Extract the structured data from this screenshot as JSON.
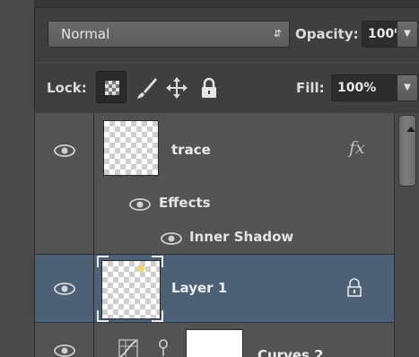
{
  "blend": {
    "mode": "Normal",
    "opacity_label": "Opacity:",
    "opacity_value": "100%"
  },
  "lock": {
    "label": "Lock:",
    "fill_label": "Fill:",
    "fill_value": "100%"
  },
  "layers": [
    {
      "name": "trace",
      "visible": true,
      "fx_label": "fx",
      "effects_label": "Effects",
      "effect_items": [
        "Inner Shadow"
      ]
    },
    {
      "name": "Layer 1",
      "visible": true,
      "selected": true,
      "locked": true
    },
    {
      "name": "Curves 2",
      "visible": true
    }
  ],
  "colors": {
    "panel_bg": "#535353",
    "selected_row": "#4d6176",
    "toolbar_bg": "#3f3f3f"
  }
}
